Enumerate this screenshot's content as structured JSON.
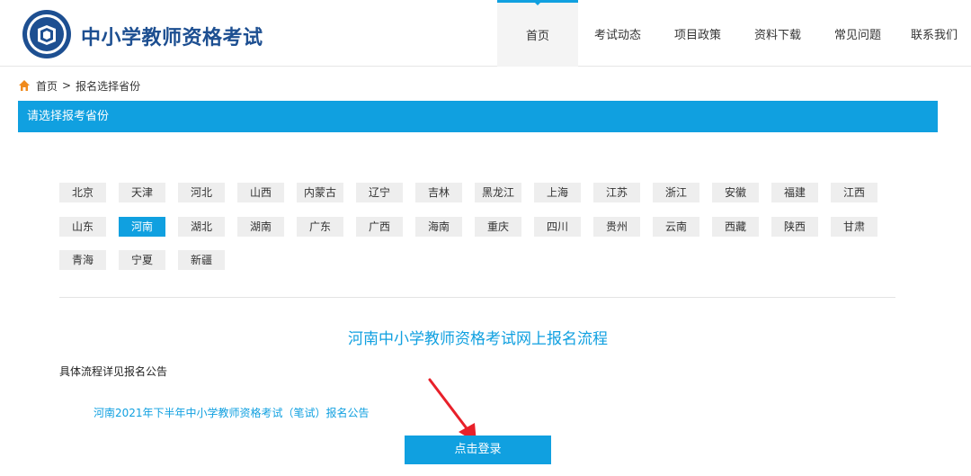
{
  "header": {
    "site_title": "中小学教师资格考试",
    "nav": [
      {
        "label": "首页",
        "active": true
      },
      {
        "label": "考试动态"
      },
      {
        "label": "项目政策"
      },
      {
        "label": "资料下载"
      },
      {
        "label": "常见问题"
      },
      {
        "label": "联系我们"
      }
    ]
  },
  "breadcrumb": {
    "home": "首页",
    "separator": ">",
    "current": "报名选择省份"
  },
  "section": {
    "title": "请选择报考省份"
  },
  "provinces": {
    "items": [
      "北京",
      "天津",
      "河北",
      "山西",
      "内蒙古",
      "辽宁",
      "吉林",
      "黑龙江",
      "上海",
      "江苏",
      "浙江",
      "安徽",
      "福建",
      "江西",
      "山东",
      "河南",
      "湖北",
      "湖南",
      "广东",
      "广西",
      "海南",
      "重庆",
      "四川",
      "贵州",
      "云南",
      "西藏",
      "陕西",
      "甘肃",
      "青海",
      "宁夏",
      "新疆"
    ],
    "selected": "河南"
  },
  "flow": {
    "title": "河南中小学教师资格考试网上报名流程",
    "note": "具体流程详见报名公告",
    "notice_link": "河南2021年下半年中小学教师资格考试（笔试）报名公告",
    "login_button": "点击登录"
  },
  "colors": {
    "accent": "#10a0e0",
    "brand": "#1d4f91",
    "annotation": "#e8202a"
  }
}
